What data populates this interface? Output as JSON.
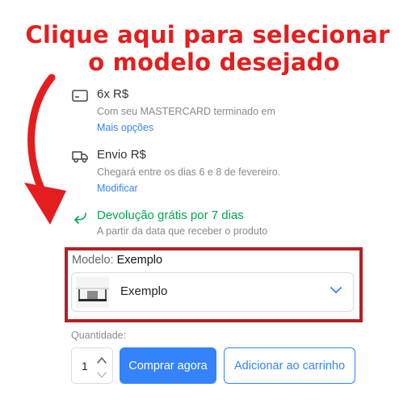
{
  "annotation": {
    "line1": "Clique aqui para selecionar",
    "line2": "o modelo desejado",
    "color": "#e41e1e",
    "frame_color": "#b51f24"
  },
  "payment": {
    "icon": "credit-card-icon",
    "title": "6x R$",
    "subtitle": "Com seu MASTERCARD terminado em",
    "link": "Mais opções"
  },
  "shipping": {
    "icon": "truck-icon",
    "title": "Envio R$",
    "subtitle": "Chegará entre os dias 6 e 8 de fevereiro.",
    "link": "Modificar"
  },
  "returns": {
    "icon": "return-arrow-icon",
    "title": "Devolução grátis por 7 dias",
    "subtitle": "A partir da data que receber o produto",
    "color": "#00a650"
  },
  "model": {
    "label": "Modelo:",
    "selected": "Exemplo",
    "option": "Exemplo",
    "icon": "chevron-down-icon"
  },
  "quantity": {
    "label": "Quantidade:",
    "value": "1"
  },
  "actions": {
    "buy_now": "Comprar agora",
    "add_to_cart": "Adicionar ao carrinho",
    "accent": "#3483fa"
  }
}
